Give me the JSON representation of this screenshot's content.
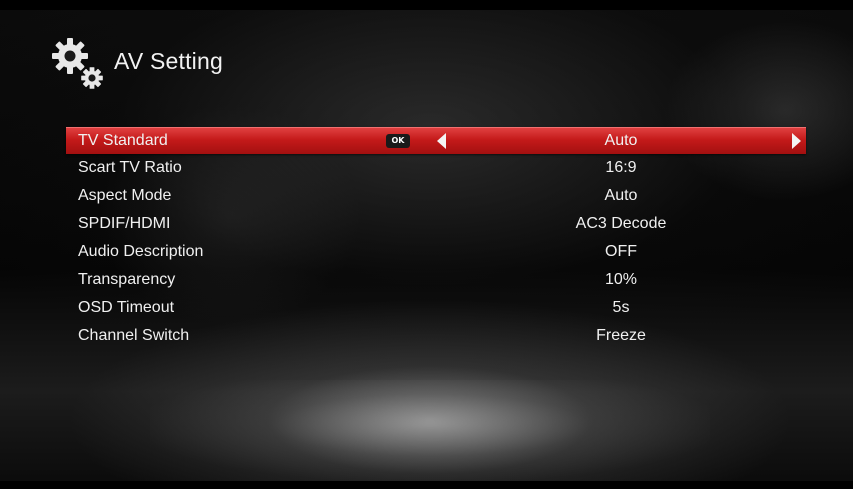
{
  "header": {
    "title": "AV Setting",
    "icon": "settings-gears-icon"
  },
  "colors": {
    "highlight": "#c41a1a",
    "text": "#f0f0f0",
    "background": "#0a0a0a"
  },
  "selected_row": {
    "ok_badge": "OK",
    "left_arrow_icon": "arrow-left-icon",
    "right_arrow_icon": "arrow-right-icon"
  },
  "menu": {
    "items": [
      {
        "label": "TV Standard",
        "value": "Auto"
      },
      {
        "label": "Scart TV Ratio",
        "value": "16:9"
      },
      {
        "label": "Aspect Mode",
        "value": "Auto"
      },
      {
        "label": "SPDIF/HDMI",
        "value": "AC3 Decode"
      },
      {
        "label": "Audio Description",
        "value": "OFF"
      },
      {
        "label": "Transparency",
        "value": "10%"
      },
      {
        "label": "OSD Timeout",
        "value": "5s"
      },
      {
        "label": "Channel Switch",
        "value": "Freeze"
      }
    ]
  }
}
